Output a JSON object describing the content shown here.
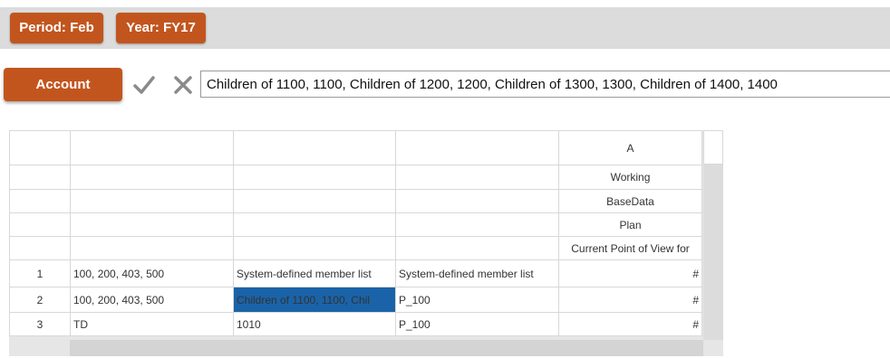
{
  "pov": {
    "period_label": "Period: Feb",
    "year_label": "Year: FY17"
  },
  "toolbar": {
    "account_label": "Account",
    "member_selection_value": "Children of 1100, 1100, Children of 1200, 1200, Children of 1300, 1300, Children of 1400, 1400"
  },
  "grid": {
    "column_header": "A",
    "header_rows": [
      "Working",
      "BaseData",
      "Plan",
      "Current Point of View for"
    ],
    "rows": [
      {
        "num": "1",
        "c1": "100, 200, 403, 500",
        "c2": "System-defined member list",
        "c3": "System-defined member list",
        "c4": "#"
      },
      {
        "num": "2",
        "c1": "100, 200, 403, 500",
        "c2": "Children of 1100, 1100, Chil",
        "c3": "P_100",
        "c4": "#"
      },
      {
        "num": "3",
        "c1": "TD",
        "c2": "1010",
        "c3": "P_100",
        "c4": "#"
      }
    ]
  },
  "colors": {
    "accent": "#c2551e",
    "selection": "#1a63a8"
  }
}
